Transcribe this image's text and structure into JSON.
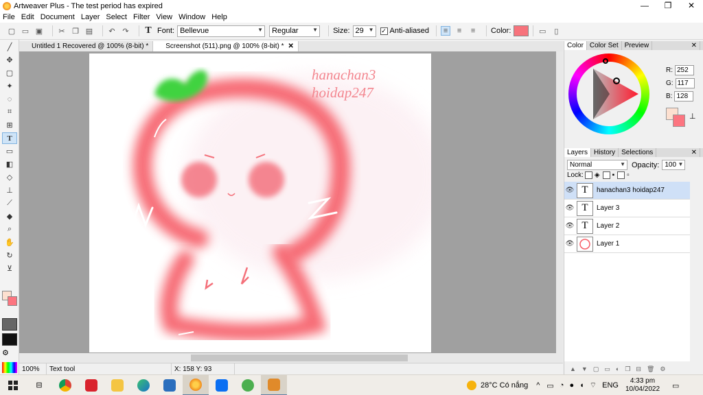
{
  "window": {
    "title": "Artweaver Plus - The test period has expired",
    "controls": [
      "—",
      "❐",
      "✕"
    ]
  },
  "menu": [
    "File",
    "Edit",
    "Document",
    "Layer",
    "Select",
    "Filter",
    "View",
    "Window",
    "Help"
  ],
  "toolbar": {
    "font_label": "Font:",
    "font_value": "Bellevue",
    "style_value": "Regular",
    "size_label": "Size:",
    "size_value": "29",
    "antialias_label": "Anti-aliased",
    "color_label": "Color:",
    "text_color": "#f7737c"
  },
  "tabs": [
    {
      "label": "Untitled 1 Recovered @ 100% (8-bit) *"
    },
    {
      "label": "Screenshot (511).png @ 100% (8-bit) *",
      "close": "✕"
    }
  ],
  "canvas_text": {
    "line1": "hanachan3",
    "line2": "hoidap247"
  },
  "status": {
    "zoom": "100%",
    "tool": "Text tool",
    "coords": "X: 158  Y: 93"
  },
  "color_panel": {
    "tabs": [
      "Color",
      "Color Set",
      "Preview"
    ],
    "r_label": "R:",
    "r": "252",
    "g_label": "G:",
    "g": "117",
    "b_label": "B:",
    "b": "128",
    "foreground": "#fc7580",
    "background": "#fde0d0"
  },
  "layers_panel": {
    "tabs": [
      "Layers",
      "History",
      "Selections"
    ],
    "blend_mode": "Normal",
    "opacity_label": "Opacity:",
    "opacity": "100",
    "lock_label": "Lock:",
    "layers": [
      {
        "name": "hanachan3 hoidap247",
        "icon": "T"
      },
      {
        "name": "Layer 3",
        "icon": "T"
      },
      {
        "name": "Layer 2",
        "icon": "T"
      },
      {
        "name": "Layer 1",
        "icon": ""
      }
    ]
  },
  "taskbar": {
    "weather": "28°C  Có nắng",
    "language": "ENG",
    "time": "4:33 pm",
    "date": "10/04/2022"
  }
}
